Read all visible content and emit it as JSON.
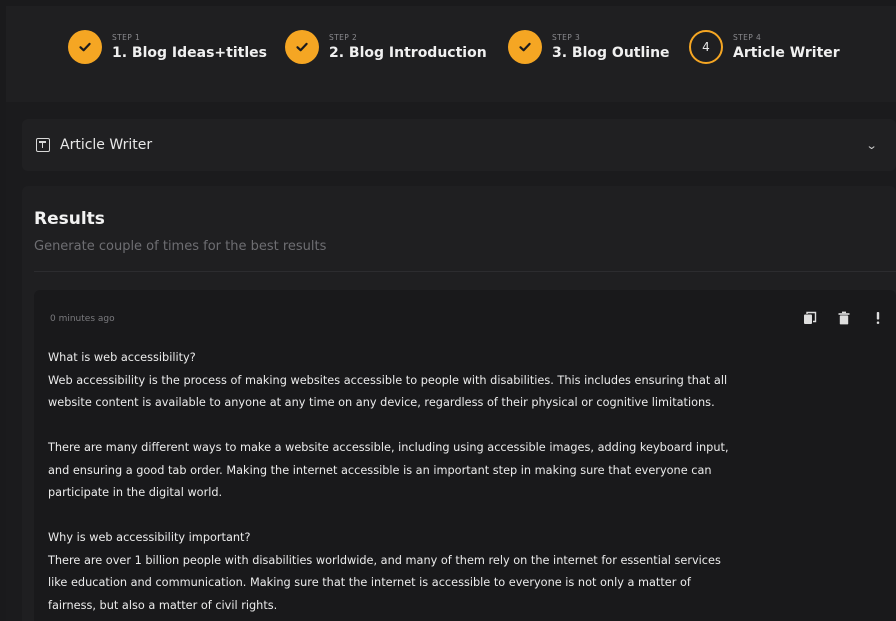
{
  "stepper": {
    "steps": [
      {
        "kicker": "STEP 1",
        "title": "1. Blog Ideas+titles",
        "status": "done"
      },
      {
        "kicker": "STEP 2",
        "title": "2. Blog Introduction",
        "status": "done"
      },
      {
        "kicker": "STEP 3",
        "title": "3. Blog Outline",
        "status": "done"
      },
      {
        "kicker": "STEP 4",
        "title": "Article Writer",
        "status": "current",
        "number": "4"
      }
    ]
  },
  "section": {
    "title": "Article Writer",
    "chevron": "⌄"
  },
  "results": {
    "title": "Results",
    "subtitle": "Generate couple of times for the best results",
    "entry": {
      "timestamp": "0 minutes ago",
      "lines": [
        "What is web accessibility?",
        "Web accessibility is the process of making websites accessible to people with disabilities. This includes ensuring that all",
        "website content is available to anyone at any time on any device, regardless of their physical or cognitive limitations.",
        "",
        "There are many different ways to make a website accessible, including using accessible images, adding keyboard input,",
        "and ensuring a good tab order. Making the internet accessible is an important step in making sure that everyone can",
        "participate in the digital world.",
        "",
        "Why is web accessibility important?",
        "There are over 1 billion people with disabilities worldwide, and many of them rely on the internet for essential services",
        "like education and communication. Making sure that the internet is accessible to everyone is not only a matter of",
        "fairness, but also a matter of civil rights."
      ]
    }
  },
  "icons": {
    "step_done": "check-icon",
    "section": "plus-square-icon",
    "actions": [
      "copy-icon",
      "trash-icon",
      "more-vertical-icon"
    ]
  },
  "colors": {
    "accent": "#f5a623",
    "background": "#1b1b1d",
    "card": "#1f1f21"
  }
}
